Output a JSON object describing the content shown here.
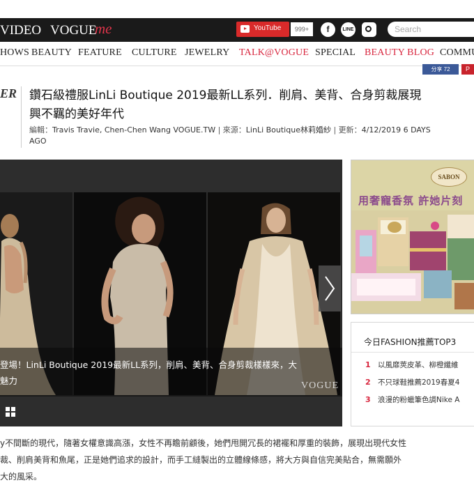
{
  "header": {
    "brand_video": "VIDEO",
    "brand_vogue": "VOGUE",
    "brand_me": "me",
    "youtube_label": "YouTube",
    "youtube_count": "999+",
    "facebook_icon": "f",
    "line_icon": "LINE",
    "search_placeholder": "Search"
  },
  "nav": {
    "items": [
      {
        "label": "HOWS"
      },
      {
        "label": "BEAUTY"
      },
      {
        "label": "FEATURE"
      },
      {
        "label": "CULTURE"
      },
      {
        "label": "JEWELRY"
      },
      {
        "label": "TALK@VOGUE"
      },
      {
        "label": "SPECIAL"
      },
      {
        "label": "BEAUTY BLOG"
      },
      {
        "label": "COMMU"
      }
    ]
  },
  "share": {
    "fb_label": "分享 72",
    "pin_label": "P"
  },
  "article": {
    "category": "ER",
    "title_line1": "鑽石級禮服LinLi Boutique 2019最新LL系列．削肩、美背、合身剪裁展現",
    "title_line2": "興不羈的美好年代",
    "byline_editor_label": "編輯：",
    "byline_editor": "Travis Travie, Chen-Chen Wang  VOGUE.TW",
    "byline_source_label": "來源：",
    "byline_source": "LinLi Boutique林莉婚紗",
    "byline_updated_label": "更新：",
    "byline_updated": "4/12/2019  6 DAYS",
    "byline_ago": "AGO"
  },
  "slideshow": {
    "caption_line1": "登場！LinLi Boutique 2019最新LL系列，削肩、美背、合身剪裁樣樣來，大",
    "caption_line2": "魅力",
    "watermark": "VOGUE",
    "next_icon": "chevron-right-icon",
    "grid_icon": "grid-icon"
  },
  "ad": {
    "logo": "SABON",
    "slogan": "用奢寵香氛 許她片刻"
  },
  "fashion_top": {
    "title": "今日FASHION推薦TOP3",
    "items": [
      {
        "num": "1",
        "text": "以風靡莢皮革、柳橙纖維"
      },
      {
        "num": "2",
        "text": "不只球鞋推薦2019春夏4"
      },
      {
        "num": "3",
        "text": "浪漫的粉蠟筆色調Nike A"
      }
    ]
  },
  "body": {
    "line1": "y不間斷的現代，隨著女權意識高漲，女性不再瞻前顧後，她們甩開冗長的裙襬和厚重的裝飾，展現出現代女性",
    "line2": "裁、削肩美背和魚尾，正是她們追求的設計，而手工縫製出的立體線條感，將大方與自信完美貼合，無需願外",
    "line3": "大的風采。"
  },
  "colors": {
    "topbar": "#1a1a1a",
    "accent_red": "#d8263e",
    "youtube_red": "#d92a2a",
    "ad_bg": "#dcd5a6",
    "ad_slogan": "#8b4a8c"
  }
}
